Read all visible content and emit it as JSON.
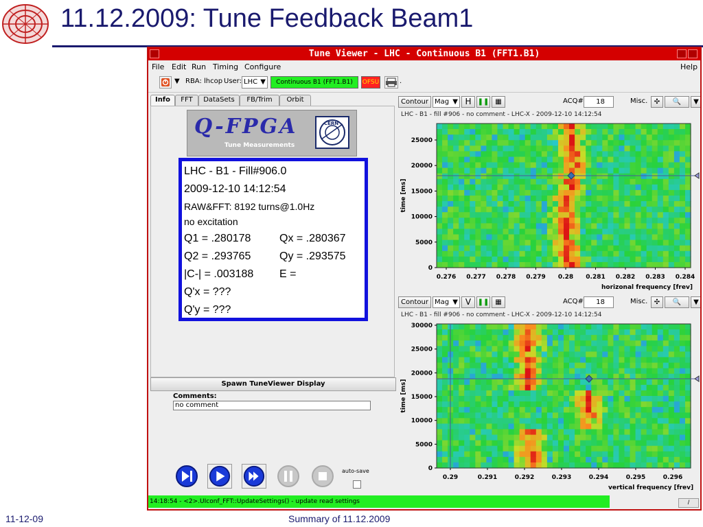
{
  "slide": {
    "title": "11.12.2009: Tune Feedback Beam1",
    "footer_left": "11-12-09",
    "footer_center": "Summary of 11.12.2009"
  },
  "window": {
    "title": "Tune Viewer - LHC - Continuous B1 (FFT1.B1)",
    "menu": [
      "File",
      "Edit",
      "Run",
      "Timing",
      "Configure"
    ],
    "help": "Help"
  },
  "toolbar": {
    "rba_label": "RBA: lhcop",
    "user_label": "User:",
    "user_value": "LHC",
    "mode": "Continuous B1 (FFT1.B1)",
    "ofsu": "OFSU",
    "dot": "."
  },
  "tabs": [
    "Info",
    "FFT",
    "DataSets",
    "FB/Trim",
    "Orbit"
  ],
  "qfpga": {
    "title": "Q-FPGA",
    "subtitle": "Tune Measurements",
    "cern": "CERN"
  },
  "info": {
    "line1": "LHC - B1 - Fill#906.0",
    "line2": "2009-12-10 14:12:54",
    "line3": "RAW&FFT: 8192 turns@1.0Hz",
    "line4": "no excitation",
    "q1": "Q1 =  .280178",
    "qx": "Qx =  .280367",
    "q2": "Q2 =  .293765",
    "qy": "Qy =  .293575",
    "c": "|C-| =  .003188",
    "e": "E =",
    "qpx": "Q'x =  ???",
    "qpy": "Q'y =  ???"
  },
  "spawn_label": "Spawn TuneViewer Display",
  "comments": {
    "label": "Comments:",
    "value": "no comment"
  },
  "autosave_label": "auto-save",
  "status": {
    "message": "14:18:54 - <2>.UIconf_FFT::UpdateSettings() - update read settings",
    "right": "/"
  },
  "plots": [
    {
      "contour": "Contour",
      "mag": "Mag",
      "axis_btn": "H",
      "acq_label": "ACQ#",
      "acq_value": "18",
      "misc": "Misc.",
      "header": "LHC - B1 - fill #906 - no comment - LHC-X - 2009-12-10 14:12:54",
      "ylabel": "time [ms]",
      "xlabel": "horizonal frequency [frev]",
      "yticks": [
        "25000",
        "20000",
        "15000",
        "10000",
        "5000",
        "0"
      ],
      "xticks": [
        "0.276",
        "0.277",
        "0.278",
        "0.279",
        "0.28",
        "0.281",
        "0.282",
        "0.283",
        "0.284"
      ]
    },
    {
      "contour": "Contour",
      "mag": "Mag",
      "axis_btn": "V",
      "acq_label": "ACQ#",
      "acq_value": "18",
      "misc": "Misc.",
      "header": "LHC - B1 - fill #906 - no comment - LHC-X - 2009-12-10 14:12:54",
      "ylabel": "time [ms]",
      "xlabel": "vertical frequency [frev]",
      "yticks": [
        "30000",
        "25000",
        "20000",
        "15000",
        "10000",
        "5000",
        "0"
      ],
      "xticks": [
        "0.29",
        "0.291",
        "0.292",
        "0.293",
        "0.294",
        "0.295",
        "0.296"
      ]
    }
  ],
  "colors": {
    "window_border": "#c01010",
    "titlebar": "#d40000",
    "info_border": "#1111dd",
    "status_bg": "#22ee22",
    "mode_bg": "#22ee22",
    "ofsu_bg": "#ff2222",
    "slide_title": "#1a1a6e"
  }
}
